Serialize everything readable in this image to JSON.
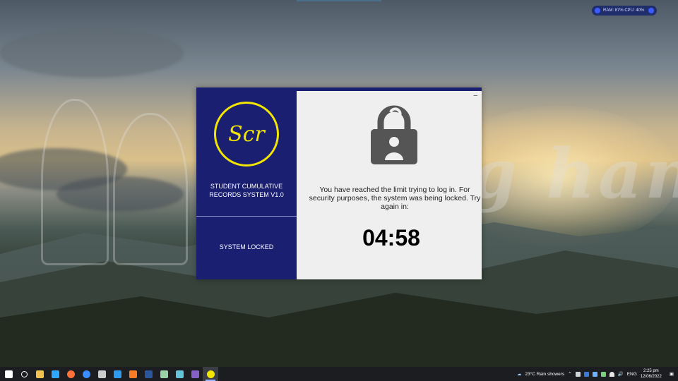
{
  "system_monitor": {
    "text": "RAM: 87%   CPU: 40%"
  },
  "desktop": {
    "watermark": "helping hand"
  },
  "dialog": {
    "logo_text": "Scr",
    "app_title": "STUDENT CUMULATIVE RECORDS SYSTEM V1.0",
    "status": "SYSTEM LOCKED",
    "minimize_label": "–",
    "message": "You have reached the limit trying to log in. For security purposes, the system was being locked. Try again in:",
    "countdown": "04:58",
    "lock_icon": "padlock-user-icon",
    "colors": {
      "panel": "#1a1f72",
      "logo": "#f2e600",
      "content_bg": "#efefef"
    }
  },
  "taskbar": {
    "apps": [
      {
        "icon": "windows-start-icon",
        "color": "#ffffff"
      },
      {
        "icon": "search-icon",
        "color": "#ffffff"
      },
      {
        "icon": "file-explorer-icon",
        "color": "#f2c14e"
      },
      {
        "icon": "photoshop-icon",
        "color": "#31a8ff"
      },
      {
        "icon": "firefox-icon",
        "color": "#ff7139"
      },
      {
        "icon": "firefox-dev-icon",
        "color": "#3a8dff"
      },
      {
        "icon": "terminal-icon",
        "color": "#cccccc"
      },
      {
        "icon": "vscode-icon",
        "color": "#2f9bf0"
      },
      {
        "icon": "xampp-icon",
        "color": "#fb7a24"
      },
      {
        "icon": "word-icon",
        "color": "#2b579a"
      },
      {
        "icon": "app-icon",
        "color": "#9bd3a8"
      },
      {
        "icon": "app-icon-2",
        "color": "#63c4d9"
      },
      {
        "icon": "visual-studio-icon",
        "color": "#8661c5"
      },
      {
        "icon": "scr-app-icon",
        "color": "#f2e600"
      }
    ],
    "weather": "23°C  Rain showers",
    "language": "ENG",
    "time": "2:25 pm",
    "date": "12/06/2022"
  }
}
